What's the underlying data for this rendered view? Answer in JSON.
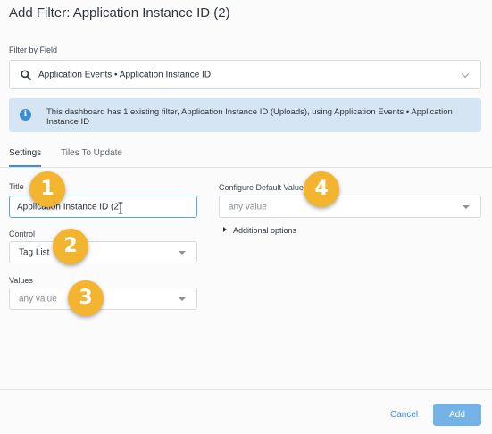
{
  "dialog": {
    "title": "Add Filter: Application Instance ID (2)"
  },
  "filter_by_field": {
    "label": "Filter by Field",
    "value": "Application Events • Application Instance ID",
    "icon": "search-icon"
  },
  "info_banner": {
    "icon": "info-icon",
    "text": "This dashboard has 1 existing filter, Application Instance ID (Uploads), using Application Events • Application Instance ID"
  },
  "tabs": [
    {
      "label": "Settings",
      "active": true
    },
    {
      "label": "Tiles To Update",
      "active": false
    }
  ],
  "settings": {
    "title_label": "Title",
    "title_value": "Application Instance ID (2",
    "control_label": "Control",
    "control_value": "Tag List",
    "values_label": "Values",
    "values_placeholder": "any value",
    "default_label": "Configure Default Value",
    "default_placeholder": "any value",
    "additional_options": "Additional options"
  },
  "badges": [
    "1",
    "2",
    "3",
    "4"
  ],
  "footer": {
    "cancel_label": "Cancel",
    "add_label": "Add"
  },
  "colors": {
    "accent": "#3b8fd6",
    "badge": "#f3b52f",
    "info_bg": "#d6e5f4",
    "add_button": "#75b3e6"
  }
}
